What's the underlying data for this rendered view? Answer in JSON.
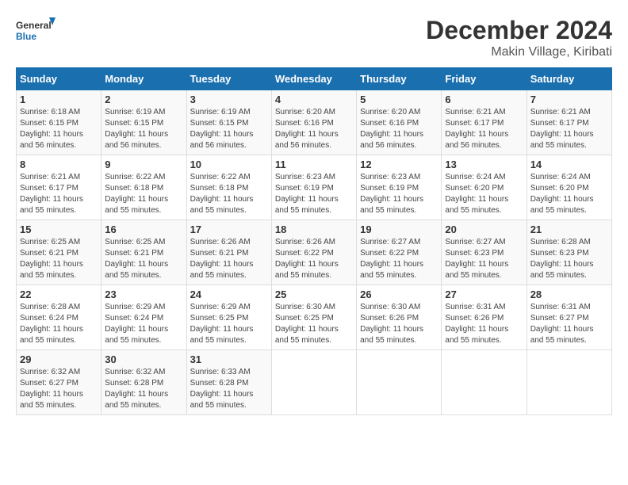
{
  "logo": {
    "text_general": "General",
    "text_blue": "Blue"
  },
  "header": {
    "title": "December 2024",
    "subtitle": "Makin Village, Kiribati"
  },
  "weekdays": [
    "Sunday",
    "Monday",
    "Tuesday",
    "Wednesday",
    "Thursday",
    "Friday",
    "Saturday"
  ],
  "weeks": [
    [
      {
        "day": "1",
        "sunrise": "6:18 AM",
        "sunset": "6:15 PM",
        "daylight": "11 hours and 56 minutes."
      },
      {
        "day": "2",
        "sunrise": "6:19 AM",
        "sunset": "6:15 PM",
        "daylight": "11 hours and 56 minutes."
      },
      {
        "day": "3",
        "sunrise": "6:19 AM",
        "sunset": "6:15 PM",
        "daylight": "11 hours and 56 minutes."
      },
      {
        "day": "4",
        "sunrise": "6:20 AM",
        "sunset": "6:16 PM",
        "daylight": "11 hours and 56 minutes."
      },
      {
        "day": "5",
        "sunrise": "6:20 AM",
        "sunset": "6:16 PM",
        "daylight": "11 hours and 56 minutes."
      },
      {
        "day": "6",
        "sunrise": "6:21 AM",
        "sunset": "6:17 PM",
        "daylight": "11 hours and 56 minutes."
      },
      {
        "day": "7",
        "sunrise": "6:21 AM",
        "sunset": "6:17 PM",
        "daylight": "11 hours and 55 minutes."
      }
    ],
    [
      {
        "day": "8",
        "sunrise": "6:21 AM",
        "sunset": "6:17 PM",
        "daylight": "11 hours and 55 minutes."
      },
      {
        "day": "9",
        "sunrise": "6:22 AM",
        "sunset": "6:18 PM",
        "daylight": "11 hours and 55 minutes."
      },
      {
        "day": "10",
        "sunrise": "6:22 AM",
        "sunset": "6:18 PM",
        "daylight": "11 hours and 55 minutes."
      },
      {
        "day": "11",
        "sunrise": "6:23 AM",
        "sunset": "6:19 PM",
        "daylight": "11 hours and 55 minutes."
      },
      {
        "day": "12",
        "sunrise": "6:23 AM",
        "sunset": "6:19 PM",
        "daylight": "11 hours and 55 minutes."
      },
      {
        "day": "13",
        "sunrise": "6:24 AM",
        "sunset": "6:20 PM",
        "daylight": "11 hours and 55 minutes."
      },
      {
        "day": "14",
        "sunrise": "6:24 AM",
        "sunset": "6:20 PM",
        "daylight": "11 hours and 55 minutes."
      }
    ],
    [
      {
        "day": "15",
        "sunrise": "6:25 AM",
        "sunset": "6:21 PM",
        "daylight": "11 hours and 55 minutes."
      },
      {
        "day": "16",
        "sunrise": "6:25 AM",
        "sunset": "6:21 PM",
        "daylight": "11 hours and 55 minutes."
      },
      {
        "day": "17",
        "sunrise": "6:26 AM",
        "sunset": "6:21 PM",
        "daylight": "11 hours and 55 minutes."
      },
      {
        "day": "18",
        "sunrise": "6:26 AM",
        "sunset": "6:22 PM",
        "daylight": "11 hours and 55 minutes."
      },
      {
        "day": "19",
        "sunrise": "6:27 AM",
        "sunset": "6:22 PM",
        "daylight": "11 hours and 55 minutes."
      },
      {
        "day": "20",
        "sunrise": "6:27 AM",
        "sunset": "6:23 PM",
        "daylight": "11 hours and 55 minutes."
      },
      {
        "day": "21",
        "sunrise": "6:28 AM",
        "sunset": "6:23 PM",
        "daylight": "11 hours and 55 minutes."
      }
    ],
    [
      {
        "day": "22",
        "sunrise": "6:28 AM",
        "sunset": "6:24 PM",
        "daylight": "11 hours and 55 minutes."
      },
      {
        "day": "23",
        "sunrise": "6:29 AM",
        "sunset": "6:24 PM",
        "daylight": "11 hours and 55 minutes."
      },
      {
        "day": "24",
        "sunrise": "6:29 AM",
        "sunset": "6:25 PM",
        "daylight": "11 hours and 55 minutes."
      },
      {
        "day": "25",
        "sunrise": "6:30 AM",
        "sunset": "6:25 PM",
        "daylight": "11 hours and 55 minutes."
      },
      {
        "day": "26",
        "sunrise": "6:30 AM",
        "sunset": "6:26 PM",
        "daylight": "11 hours and 55 minutes."
      },
      {
        "day": "27",
        "sunrise": "6:31 AM",
        "sunset": "6:26 PM",
        "daylight": "11 hours and 55 minutes."
      },
      {
        "day": "28",
        "sunrise": "6:31 AM",
        "sunset": "6:27 PM",
        "daylight": "11 hours and 55 minutes."
      }
    ],
    [
      {
        "day": "29",
        "sunrise": "6:32 AM",
        "sunset": "6:27 PM",
        "daylight": "11 hours and 55 minutes."
      },
      {
        "day": "30",
        "sunrise": "6:32 AM",
        "sunset": "6:28 PM",
        "daylight": "11 hours and 55 minutes."
      },
      {
        "day": "31",
        "sunrise": "6:33 AM",
        "sunset": "6:28 PM",
        "daylight": "11 hours and 55 minutes."
      },
      null,
      null,
      null,
      null
    ]
  ],
  "labels": {
    "sunrise": "Sunrise: ",
    "sunset": "Sunset: ",
    "daylight": "Daylight: "
  }
}
